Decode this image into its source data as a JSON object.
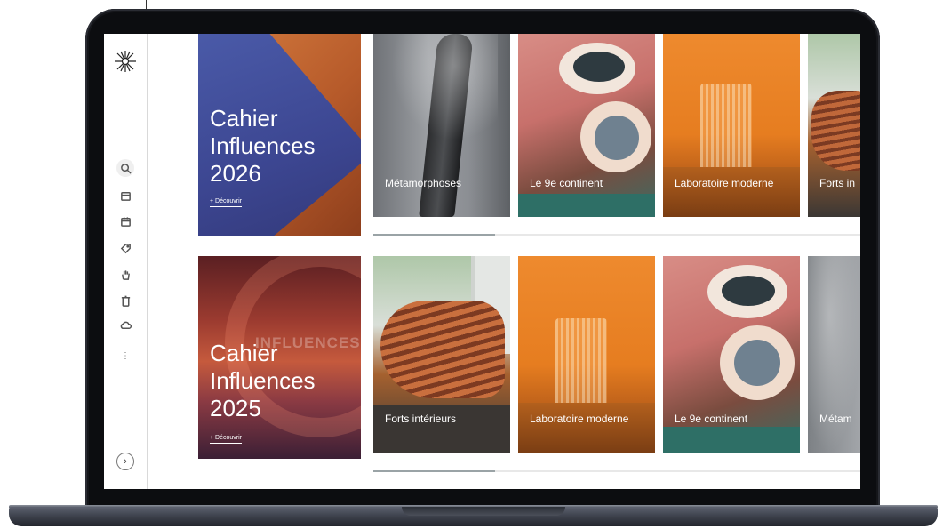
{
  "sidebar": {
    "logo": "star-logo",
    "icons": [
      "search-icon",
      "box-icon",
      "calendar-icon",
      "tag-icon",
      "hand-icon",
      "trash-icon",
      "cloud-icon",
      "more-icon"
    ],
    "expand": "›"
  },
  "rows": [
    {
      "hero": {
        "title_line1": "Cahier",
        "title_line2": "Influences",
        "title_line3": "2026",
        "link": "+ Découvrir"
      },
      "cards": [
        "Métamorphoses",
        "Le 9e continent",
        "Laboratoire moderne",
        "Forts in"
      ],
      "scroll_progress": 0.25
    },
    {
      "hero": {
        "ghost": "INFLUENCES",
        "title_line1": "Cahier",
        "title_line2": "Influences",
        "title_line3": "2025",
        "link": "+ Découvrir"
      },
      "cards": [
        "Forts intérieurs",
        "Laboratoire moderne",
        "Le 9e continent",
        "Métam"
      ],
      "scroll_progress": 0.25
    }
  ]
}
